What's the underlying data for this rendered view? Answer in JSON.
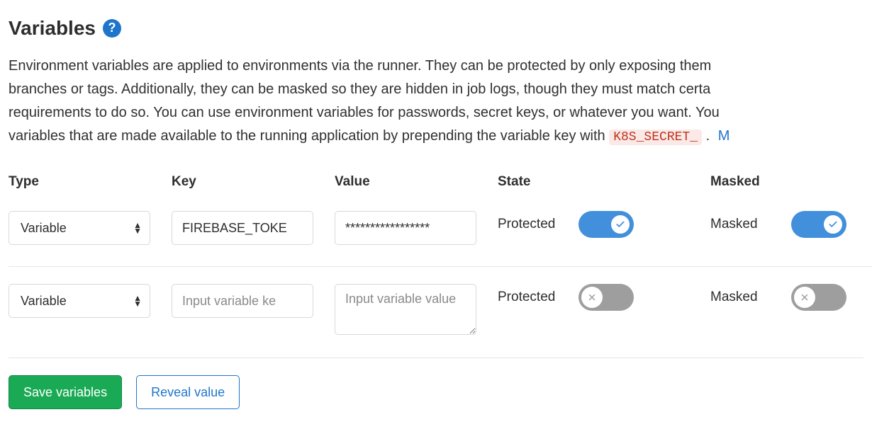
{
  "header": {
    "title": "Variables"
  },
  "description": {
    "line1": "Environment variables are applied to environments via the runner. They can be protected by only exposing them ",
    "line2": "branches or tags. Additionally, they can be masked so they are hidden in job logs, though they must match certa",
    "line3": "requirements to do so. You can use environment variables for passwords, secret keys, or whatever you want. You",
    "line4_pre": "variables that are made available to the running application by prepending the variable key with ",
    "code": "K8S_SECRET_",
    "line4_post": ".",
    "more_char": "M"
  },
  "columns": {
    "type": "Type",
    "key": "Key",
    "value": "Value",
    "state": "State",
    "masked": "Masked"
  },
  "type_options": {
    "variable": "Variable"
  },
  "state_label": "Protected",
  "masked_label": "Masked",
  "rows": [
    {
      "type": "Variable",
      "key": "FIREBASE_TOKE",
      "value": "*****************",
      "protected": true,
      "masked": true
    },
    {
      "type": "Variable",
      "key": "",
      "key_placeholder": "Input variable ke",
      "value": "",
      "value_placeholder": "Input variable value",
      "protected": false,
      "masked": false
    }
  ],
  "buttons": {
    "save": "Save variables",
    "reveal": "Reveal value"
  }
}
